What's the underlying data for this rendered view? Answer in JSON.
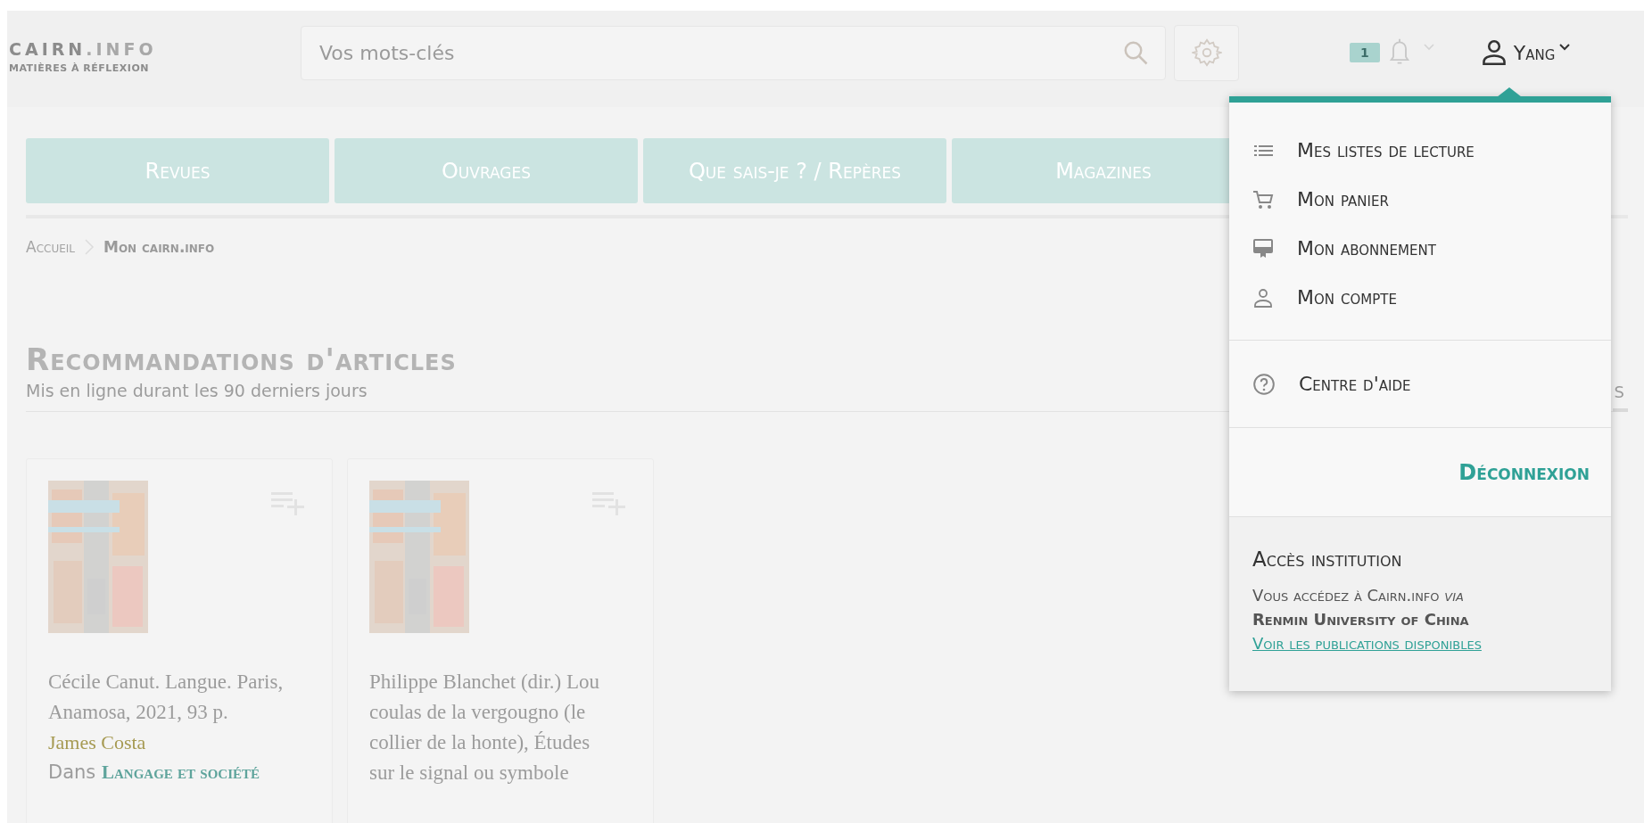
{
  "header": {
    "logo": {
      "name": "CAIRN",
      "suffix": ".INFO",
      "tagline": "MATIÈRES À RÉFLEXION"
    },
    "search": {
      "placeholder": "Vos mots-clés"
    },
    "notifications": {
      "count": "1"
    },
    "user": {
      "name": "Yang"
    }
  },
  "nav": {
    "tabs": [
      "Revues",
      "Ouvrages",
      "Que sais-je ? / Repères",
      "Magazines"
    ]
  },
  "breadcrumb": [
    "Accueil",
    "Mon cairn.info"
  ],
  "section": {
    "title": "Recommandations d'articles",
    "subtitle": "Mis en ligne durant les 90 derniers jours",
    "side_tab": "s"
  },
  "cards": [
    {
      "title": "Cécile Canut. Langue. Paris, Anamosa, 2021, 93 p.",
      "author": "James Costa",
      "source_prefix": "Dans",
      "source": "Langage et société"
    },
    {
      "title": "Philippe Blanchet (dir.) Lou coulas de la vergougno (le collier de la honte), Études sur le signal ou symbole"
    }
  ],
  "user_menu": {
    "items": [
      "Mes listes de lecture",
      "Mon panier",
      "Mon abonnement",
      "Mon compte"
    ],
    "help": "Centre d'aide",
    "logout": "Déconnexion",
    "institution": {
      "title": "Accès institution",
      "line": "Vous accédez à Cairn.info *via*",
      "org": "Renmin University of China",
      "link": "Voir les publications disponibles"
    }
  }
}
